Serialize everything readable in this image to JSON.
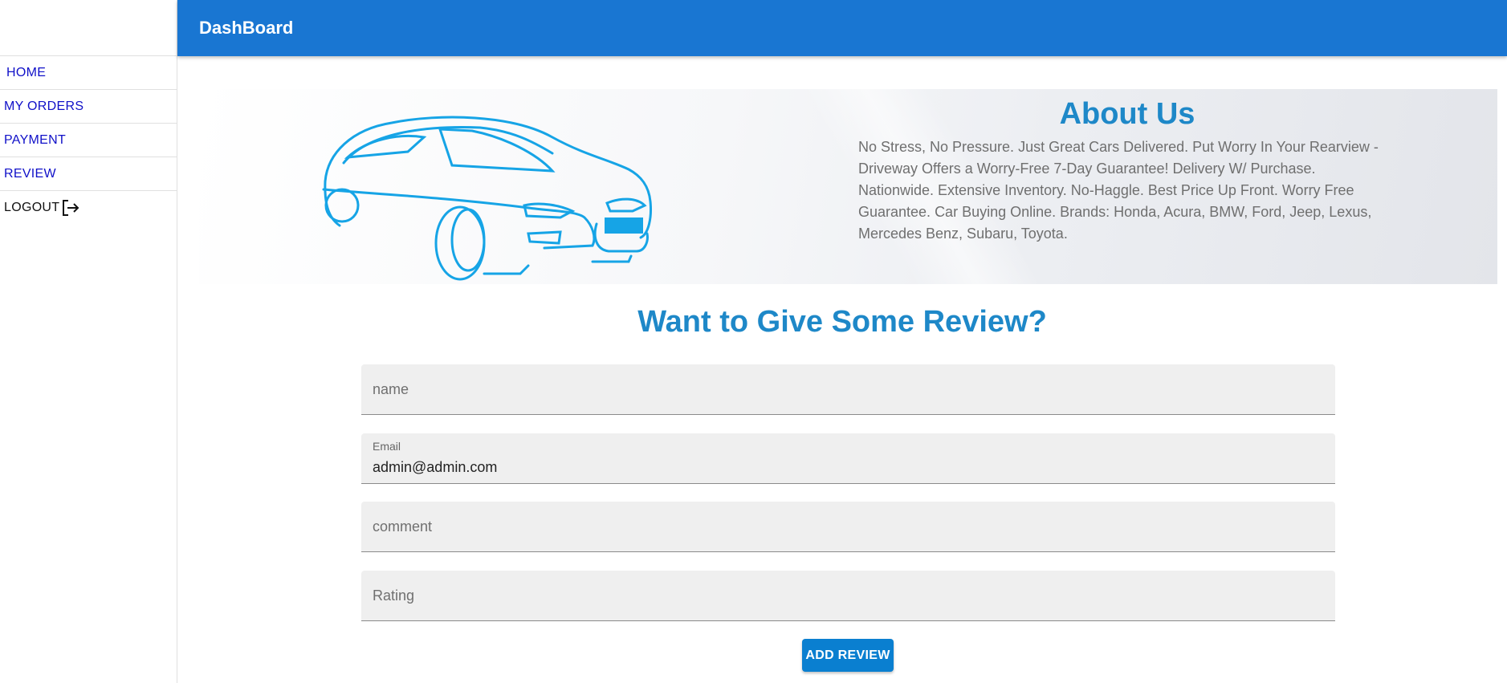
{
  "appbar": {
    "title": "DashBoard",
    "color": "#1976d2"
  },
  "sidebar": {
    "items": [
      {
        "label": "HOME"
      },
      {
        "label": "MY ORDERS"
      },
      {
        "label": "PAYMENT"
      },
      {
        "label": "REVIEW"
      }
    ],
    "logout_label": "LOGOUT",
    "logout_icon": "logout-icon",
    "link_color": "#1010c8"
  },
  "about": {
    "title": "About Us",
    "body": "No Stress, No Pressure. Just Great Cars Delivered. Put Worry In Your Rearview - Driveway Offers a Worry-Free 7-Day Guarantee! Delivery W/ Purchase. Nationwide. Extensive Inventory. No-Haggle. Best Price Up Front. Worry Free Guarantee. Car Buying Online. Brands: Honda, Acura, BMW, Ford, Jeep, Lexus, Mercedes Benz, Subaru, Toyota.",
    "image_icon": "car-outline-illustration",
    "accent_color": "#1e88c8"
  },
  "review_form": {
    "heading": "Want to Give Some Review?",
    "name_placeholder": "name",
    "email_label": "Email",
    "email_value": "admin@admin.com",
    "comment_placeholder": "comment",
    "rating_placeholder": "Rating",
    "submit_label": "ADD REVIEW",
    "button_color": "#0a7fd0"
  }
}
